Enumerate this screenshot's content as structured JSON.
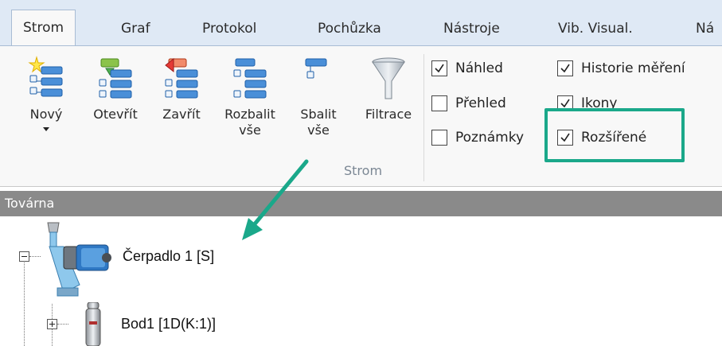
{
  "tabs": [
    {
      "label": "Strom",
      "active": true
    },
    {
      "label": "Graf"
    },
    {
      "label": "Protokol"
    },
    {
      "label": "Pochůzka"
    },
    {
      "label": "Nástroje"
    },
    {
      "label": "Vib. Visual."
    },
    {
      "label": "Ná"
    }
  ],
  "ribbon": {
    "buttons": [
      {
        "label": "Nový",
        "icon": "new-tree-icon"
      },
      {
        "label": "Otevřít",
        "icon": "open-tree-icon"
      },
      {
        "label": "Zavřít",
        "icon": "close-tree-icon"
      },
      {
        "label_line1": "Rozbalit",
        "label_line2": "vše",
        "icon": "expand-all-icon"
      },
      {
        "label_line1": "Sbalit",
        "label_line2": "vše",
        "icon": "collapse-all-icon"
      },
      {
        "label": "Filtrace",
        "icon": "filter-icon"
      }
    ],
    "group_label": "Strom",
    "checkboxes": [
      {
        "label": "Náhled",
        "checked": true
      },
      {
        "label": "Přehled",
        "checked": false
      },
      {
        "label": "Poznámky",
        "checked": false
      },
      {
        "label": "Historie měření",
        "checked": true
      },
      {
        "label": "Ikony",
        "checked": true
      },
      {
        "label": "Rozšířené",
        "checked": true
      }
    ]
  },
  "panel": {
    "title": "Továrna"
  },
  "tree": {
    "nodes": [
      {
        "label": "Čerpadlo 1 [S]",
        "icon": "pump-icon",
        "expanded": true
      },
      {
        "label": "Bod1 [1D(K:1)]",
        "icon": "sensor-icon",
        "expanded": false
      }
    ]
  },
  "colors": {
    "highlight": "#1aa88a",
    "arrow": "#1aa88a",
    "tabstrip": "#dfe9f5",
    "panel_header": "#8a8a8a"
  }
}
